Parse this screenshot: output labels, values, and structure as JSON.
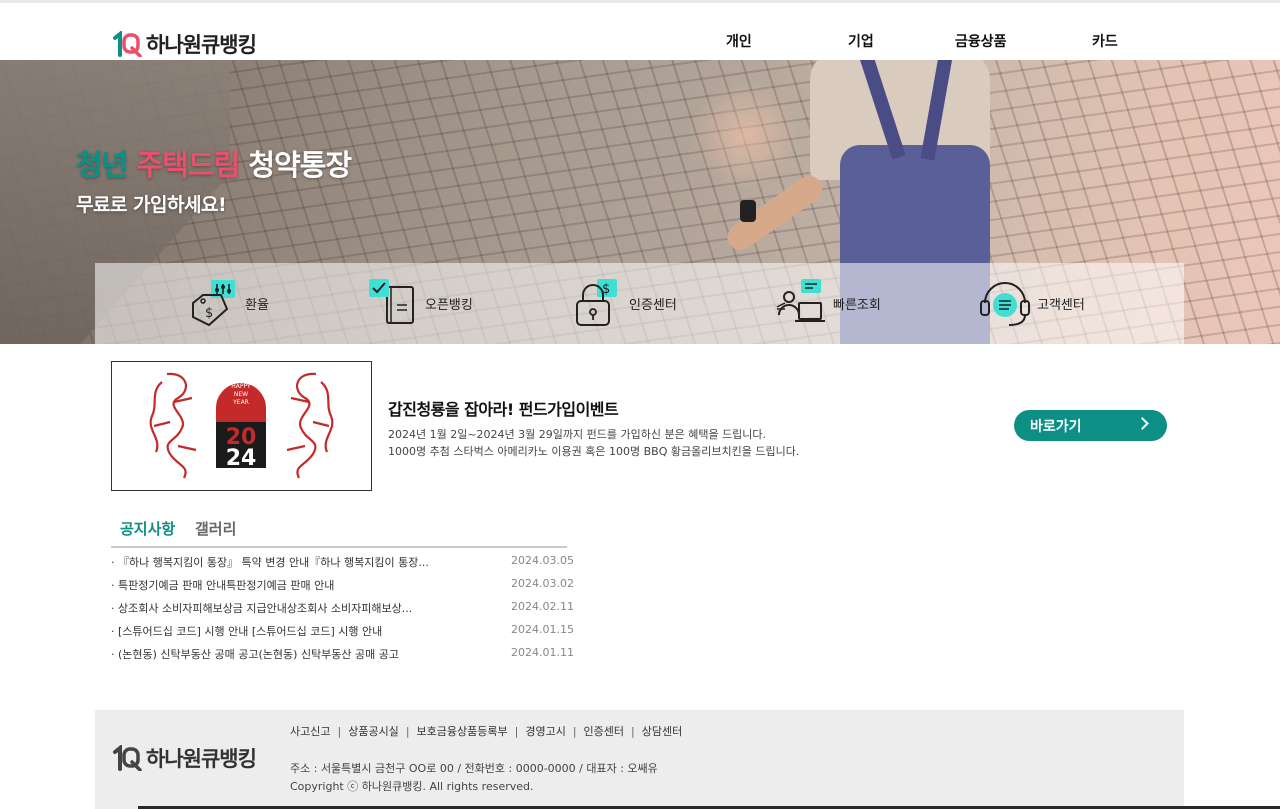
{
  "brand": {
    "name": "하나원큐뱅킹",
    "accent_color": "#0d8f85",
    "pink_color": "#e8506c"
  },
  "nav": {
    "items": [
      "개인",
      "기업",
      "금융상품",
      "카드"
    ]
  },
  "hero": {
    "title_part1": "청년",
    "title_part2": "주택드림",
    "title_part3": "청약통장",
    "subtitle": "무료로 가입하세요!"
  },
  "quick_menu": [
    {
      "label": "환율",
      "icon": "exchange-rate-icon"
    },
    {
      "label": "오픈뱅킹",
      "icon": "open-banking-icon"
    },
    {
      "label": "인증센터",
      "icon": "lock-icon"
    },
    {
      "label": "빠른조회",
      "icon": "quick-inquiry-icon"
    },
    {
      "label": "고객센터",
      "icon": "headset-icon"
    }
  ],
  "event": {
    "image_text": {
      "top": "HAPPY NEW YEAR",
      "year_top": "20",
      "year_bottom": "24"
    },
    "title": "갑진청룡을 잡아라! 펀드가입이벤트",
    "desc_line1": "2024년 1월 2일~2024년 3월 29일까지 펀드를 가입하신 분은 혜택을 드립니다.",
    "desc_line2": "1000명 추첨 스타벅스 아메리카노 이용권 혹은 100명 BBQ 황금올리브치킨을 드립니다.",
    "button_label": "바로가기"
  },
  "notice": {
    "tabs": [
      "공지사항",
      "갤러리"
    ],
    "items": [
      {
        "title": "· 『하나 행복지킴이 통장』 특약 변경 안내『하나 행복지킴이 통장...",
        "date": "2024.03.05"
      },
      {
        "title": "· 특판정기예금 판매 안내특판정기예금 판매 안내",
        "date": "2024.03.02"
      },
      {
        "title": "· 상조회사 소비자피해보상금 지급안내상조회사 소비자피해보상...",
        "date": "2024.02.11"
      },
      {
        "title": "· [스튜어드십 코드] 시행 안내 [스튜어드십 코드] 시행 안내",
        "date": "2024.01.15"
      },
      {
        "title": "· (논현동) 신탁부동산 공매 공고(논현동) 신탁부동산 공매 공고",
        "date": "2024.01.11"
      }
    ]
  },
  "footer": {
    "links": [
      "사고신고",
      "상품공시실",
      "보호금융상품등록부",
      "경영고시",
      "인증센터",
      "상담센터"
    ],
    "separator": "|",
    "address": "주소 : 서울특별시 금천구 OO로 00 / 전화번호 : 0000-0000 / 대표자 : 오쌔유",
    "copyright": "Copyright ⓒ 하나원큐뱅킹. All rights reserved."
  }
}
